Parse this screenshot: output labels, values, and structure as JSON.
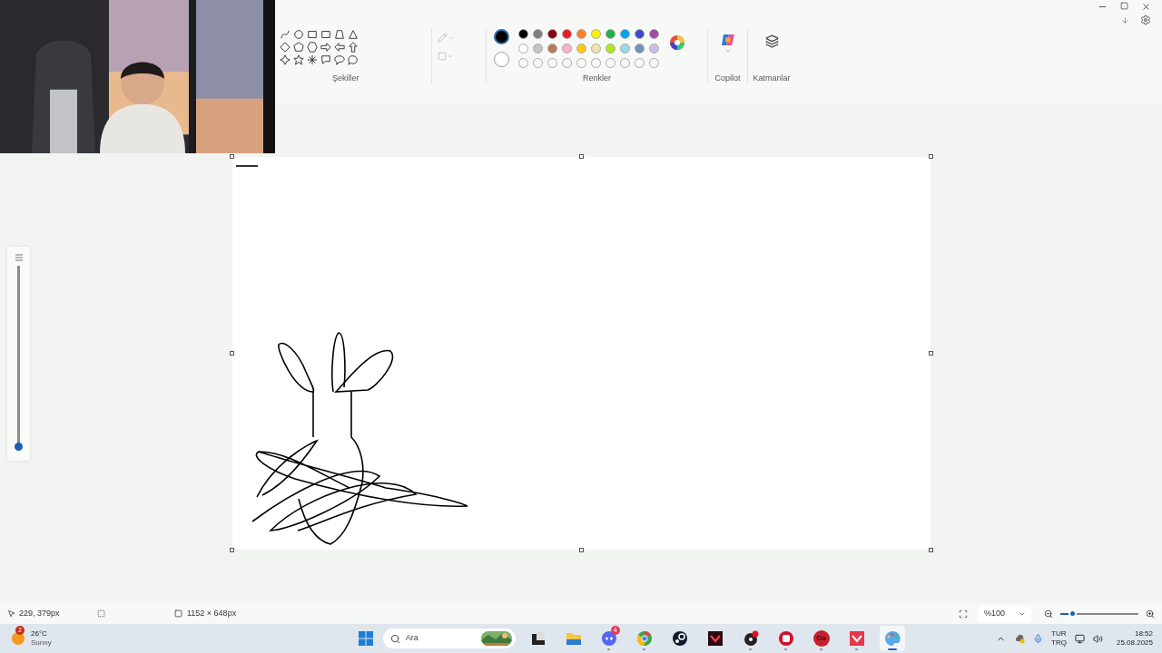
{
  "ribbon": {
    "shapes_label": "Şekiller",
    "colors_label": "Renkler",
    "copilot_label": "Copilot",
    "layers_label": "Katmanlar"
  },
  "colors": {
    "current": [
      {
        "color": "#000000",
        "selected": true
      },
      {
        "color": "#ffffff",
        "selected": false
      }
    ],
    "palette": [
      {
        "color": "#000000"
      },
      {
        "color": "#7f7f7f"
      },
      {
        "color": "#880015"
      },
      {
        "color": "#ed1c24"
      },
      {
        "color": "#ff7f27"
      },
      {
        "color": "#fff200"
      },
      {
        "color": "#22b14c"
      },
      {
        "color": "#00a2e8"
      },
      {
        "color": "#3f48cc"
      },
      {
        "color": "#a349a4"
      },
      {
        "color": "#ffffff"
      },
      {
        "color": "#c3c3c3"
      },
      {
        "color": "#b97a57"
      },
      {
        "color": "#ffaec9"
      },
      {
        "color": "#ffc90e"
      },
      {
        "color": "#efe4b0"
      },
      {
        "color": "#b5e61d"
      },
      {
        "color": "#99d9ea"
      },
      {
        "color": "#7092be"
      },
      {
        "color": "#c8bfe7"
      }
    ]
  },
  "size_slider": {
    "level": 0.0
  },
  "status_bar": {
    "cursor": "229, 379px",
    "canvas_size": "1152 × 648px",
    "zoom": "%100",
    "zoom_slider": {
      "level": 0.15
    }
  },
  "taskbar": {
    "weather": {
      "temperature": "26°C",
      "condition": "Sunny",
      "badge": "2"
    },
    "search": {
      "placeholder": "Ara"
    },
    "apps": [
      {
        "kind": "window",
        "running": false,
        "selected": false
      },
      {
        "kind": "folder",
        "running": false,
        "selected": false
      },
      {
        "kind": "chat",
        "running": true,
        "selected": false,
        "badge": "4"
      },
      {
        "kind": "browser",
        "running": true,
        "selected": false
      },
      {
        "kind": "steam",
        "running": false,
        "selected": false
      },
      {
        "kind": "dark-v",
        "running": false,
        "selected": false
      },
      {
        "kind": "record",
        "running": true,
        "selected": false
      },
      {
        "kind": "fist",
        "running": true,
        "selected": false
      },
      {
        "kind": "co",
        "running": true,
        "selected": false,
        "label": "Co"
      },
      {
        "kind": "red-v",
        "running": true,
        "selected": false
      },
      {
        "kind": "paint",
        "running": true,
        "selected": true
      }
    ],
    "language": [
      "TUR",
      "TRQ"
    ],
    "time": "18:52",
    "date": "25.08.2025"
  }
}
